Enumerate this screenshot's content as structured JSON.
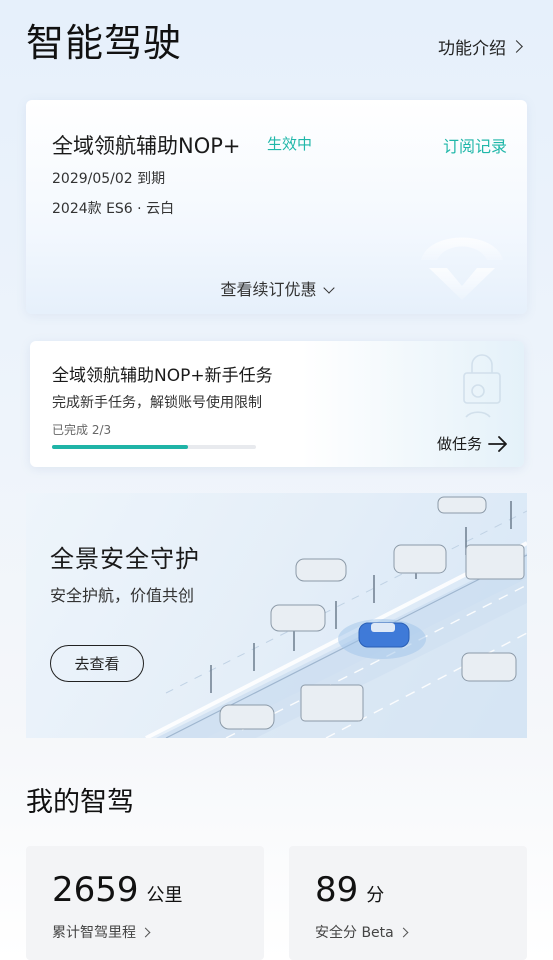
{
  "header": {
    "title": "智能驾驶",
    "feature_intro": "功能介绍"
  },
  "subscription": {
    "title": "全域领航辅助NOP+",
    "status": "生效中",
    "records_link": "订阅记录",
    "expiry": "2029/05/02 到期",
    "vehicle": "2024款 ES6 · 云白",
    "offers_link": "查看续订优惠"
  },
  "task": {
    "title": "全域领航辅助NOP+新手任务",
    "description": "完成新手任务，解锁账号使用限制",
    "progress_text": "已完成 2/3",
    "progress_fraction": 0.667,
    "action_label": "做任务"
  },
  "safety": {
    "title": "全景安全守护",
    "subtitle": "安全护航，价值共创",
    "button": "去查看"
  },
  "my_driving": {
    "section_title": "我的智驾",
    "stats": [
      {
        "value": "2659",
        "unit": "公里",
        "label": "累计智驾里程"
      },
      {
        "value": "89",
        "unit": "分",
        "label": "安全分 Beta"
      }
    ]
  },
  "colors": {
    "accent": "#20b7a9",
    "progress": "#1fb4a7",
    "highlight_car": "#3f7ad8"
  }
}
